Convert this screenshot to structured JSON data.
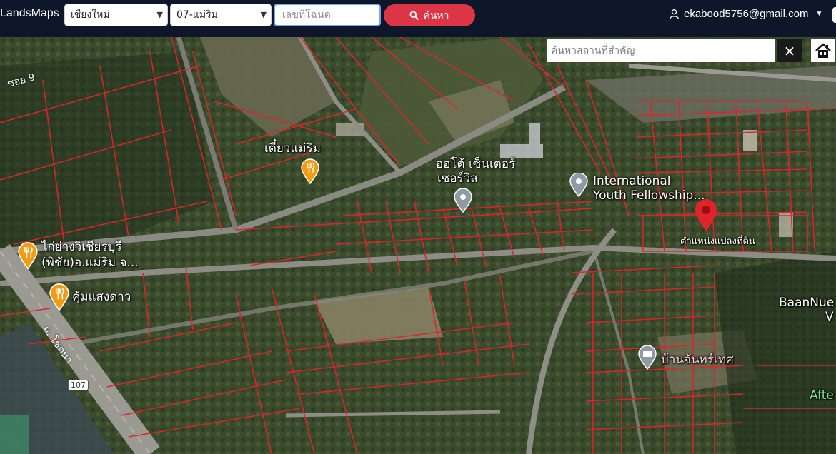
{
  "header": {
    "brand": "LandsMaps",
    "province": "เชียงใหม่",
    "district": "07-แม่ริม",
    "deed_placeholder": "เลขที่โฉนด",
    "search_label": "ค้นหา",
    "user_email": "ekabood5756@gmail.com"
  },
  "map": {
    "place_search_placeholder": "ค้นหาสถานที่สำคัญ",
    "clear_symbol": "×",
    "labels": {
      "restaurant_1": "เตี๋ยวแม่ริม",
      "auto_center_l1": "ออโต้ เซ็นเตอร์",
      "auto_center_l2": "เซอร์วิส",
      "youth_l1": "International",
      "youth_l2": "Youth Fellowship...",
      "plot_position": "ตำแหน่งแปลงที่ดิน",
      "chicken_l1": "ไก่ย่างวิเชียรบุรี",
      "chicken_l2": "(พิชัย)อ.แม่ริม จ...",
      "kum_saeng_dao": "คุ้มแสงดาว",
      "road": "ถ. โชตนา",
      "route": "107",
      "ban_chan_l1": "บ้านจันทร์เทศ",
      "baan_nue_l1": "BaanNue",
      "baan_nue_l2": "V",
      "after": "Afte",
      "soi": "ซอย 9"
    }
  }
}
